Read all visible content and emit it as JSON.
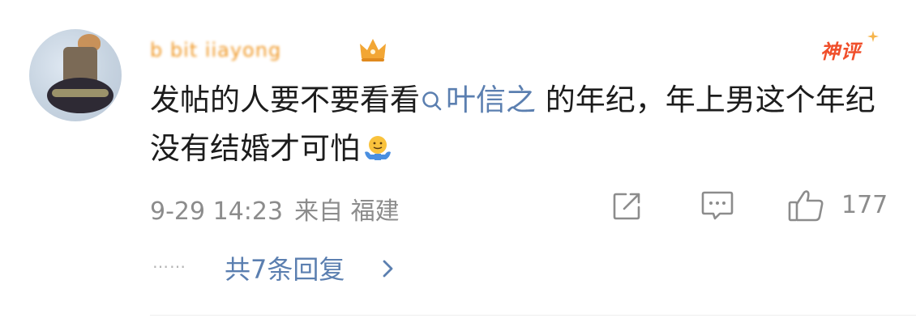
{
  "comment": {
    "username": "b   bit  iiayong",
    "badge": "神评",
    "content": {
      "before_topic": "发帖的人要不要看看",
      "topic": "叶信之",
      "after_topic": " 的年纪，年上男这个年纪没有结婚才可怕"
    },
    "emoji_icon": "shrug-emoji",
    "date": "9-29 14:23",
    "source_label": "来自 福建",
    "like_count": "177",
    "replies_label": "共7条回复",
    "dots": "……"
  },
  "colors": {
    "link": "#5b7fb0",
    "badge": "#f04f2b",
    "username": "#f09a2a",
    "meta": "#8c8c8c"
  }
}
